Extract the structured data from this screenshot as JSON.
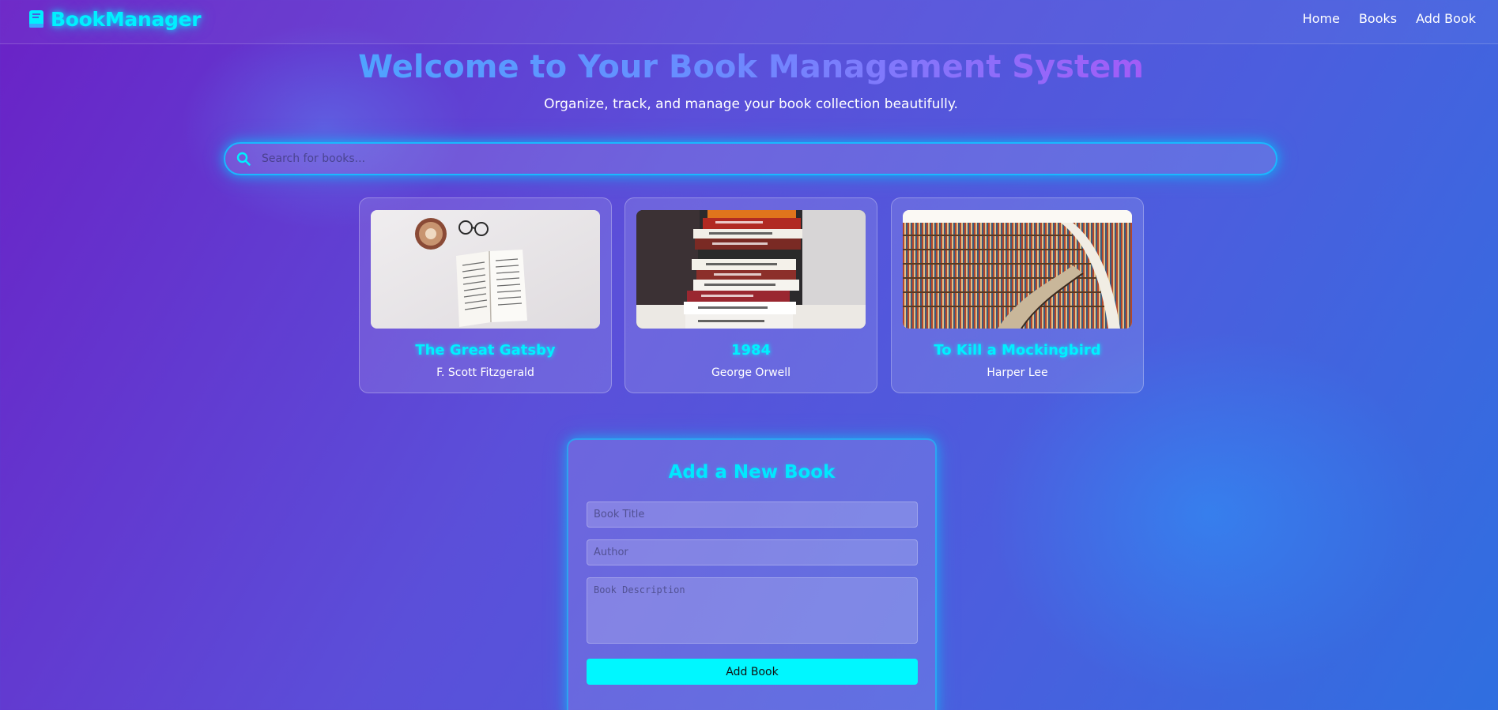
{
  "app": {
    "brand": "BookManager"
  },
  "nav": {
    "items": [
      {
        "label": "Home"
      },
      {
        "label": "Books"
      },
      {
        "label": "Add Book"
      }
    ]
  },
  "hero": {
    "title": "Welcome to Your Book Management System",
    "subtitle": "Organize, track, and manage your book collection beautifully."
  },
  "search": {
    "placeholder": "Search for books...",
    "icon": "search-icon"
  },
  "books": [
    {
      "title": "The Great Gatsby",
      "author": "F. Scott Fitzgerald",
      "image": "open-book-with-coffee-and-glasses"
    },
    {
      "title": "1984",
      "author": "George Orwell",
      "image": "stack-of-books"
    },
    {
      "title": "To Kill a Mockingbird",
      "author": "Harper Lee",
      "image": "library-bookshelves"
    }
  ],
  "form": {
    "title": "Add a New Book",
    "title_placeholder": "Book Title",
    "author_placeholder": "Author",
    "description_placeholder": "Book Description",
    "submit_label": "Add Book"
  },
  "colors": {
    "accent": "#00f0ff",
    "button": "#00f7ff",
    "background_start": "#6a22c6",
    "background_end": "#2f6fe0"
  }
}
